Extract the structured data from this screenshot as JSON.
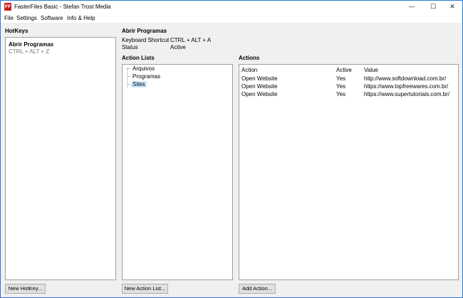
{
  "window": {
    "app_icon_text": "FF",
    "title": "FasterFiles Basic - Stefan Trost Media",
    "minimize": "—",
    "maximize": "☐",
    "close": "✕"
  },
  "menu": {
    "file": "File",
    "settings": "Settings",
    "software": "Software",
    "info_help": "Info & Help"
  },
  "hotkeys": {
    "heading": "HotKeys",
    "items": [
      {
        "name": "Abrir Programas",
        "shortcut": "CTRL + ALT + Z"
      }
    ],
    "new_button": "New HotKey..."
  },
  "details": {
    "title": "Abrir Programas",
    "shortcut_label": "Keyboard Shortcut",
    "shortcut_value": "CTRL + ALT + A",
    "status_label": "Status",
    "status_value": "Active"
  },
  "action_lists": {
    "heading": "Action Lists",
    "items": [
      "Arquivos",
      "Programas",
      "Sites"
    ],
    "selected": "Sites",
    "new_button": "New Action List..."
  },
  "actions": {
    "heading": "Actions",
    "columns": [
      "Action",
      "Active",
      "Value"
    ],
    "rows": [
      [
        "Open Website",
        "Yes",
        "http://www.softdownload.com.br/"
      ],
      [
        "Open Website",
        "Yes",
        "https://www.topfreewares.com.br/"
      ],
      [
        "Open Website",
        "Yes",
        "https://www.supertutoriais.com.br/"
      ]
    ],
    "add_button": "Add Action..."
  }
}
